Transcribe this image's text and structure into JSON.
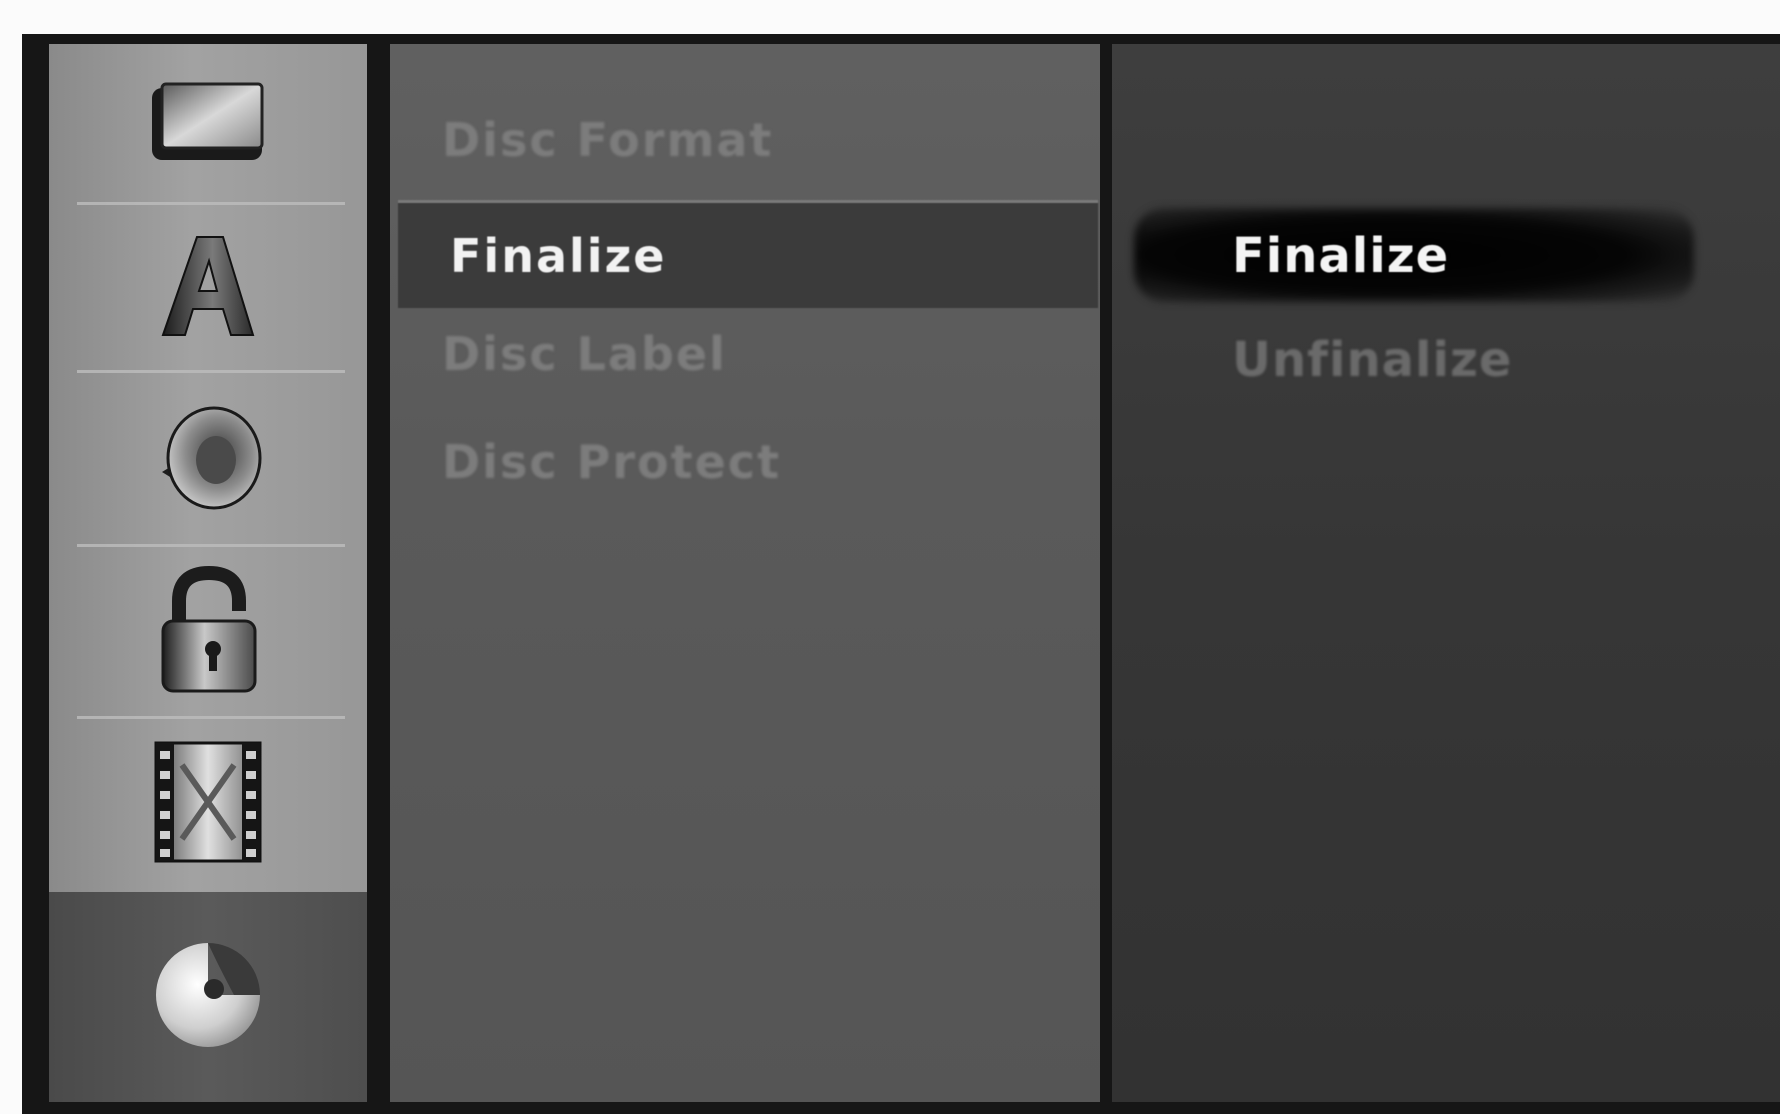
{
  "sidebar": {
    "icons": [
      {
        "name": "screen-icon",
        "selected": false
      },
      {
        "name": "language-icon",
        "selected": false
      },
      {
        "name": "audio-icon",
        "selected": false
      },
      {
        "name": "lock-icon",
        "selected": false
      },
      {
        "name": "recording-icon",
        "selected": false
      },
      {
        "name": "disc-icon",
        "selected": true
      }
    ]
  },
  "menu": {
    "items": [
      {
        "label": "Disc Format",
        "selected": false
      },
      {
        "label": "Finalize",
        "selected": true
      },
      {
        "label": "Disc Label",
        "selected": false
      },
      {
        "label": "Disc Protect",
        "selected": false
      }
    ]
  },
  "options": {
    "items": [
      {
        "label": "Finalize",
        "selected": true
      },
      {
        "label": "Unfinalize",
        "selected": false
      }
    ]
  },
  "colors": {
    "selected_text": "#f2f2f2",
    "dimmed_text": "#7c7c7c",
    "highlight_bar": "#3b3b3b"
  }
}
